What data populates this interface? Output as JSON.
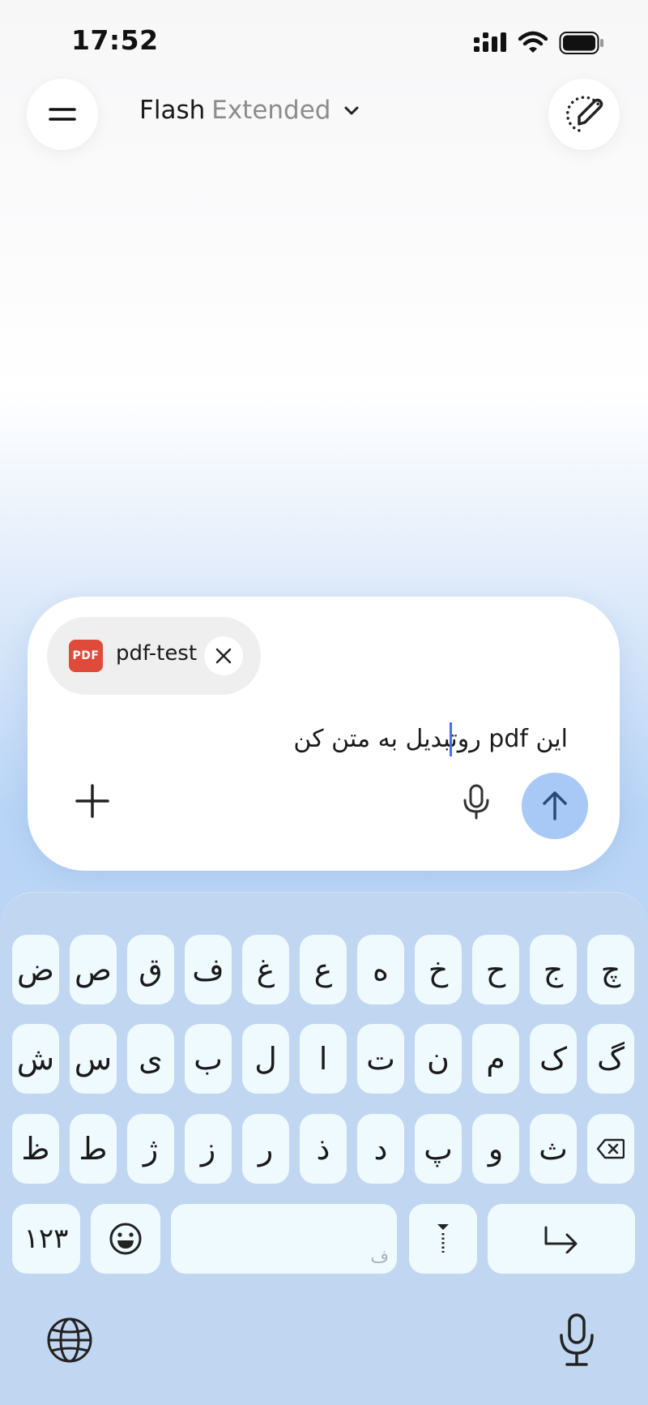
{
  "status_bar": {
    "time": "17:52"
  },
  "header": {
    "model_name": "Flash",
    "model_variant": "Extended",
    "menu_icon": "menu-icon",
    "new_chat_icon": "new-chat-icon"
  },
  "composer": {
    "attachment": {
      "badge": "PDF",
      "name": "pdf-test"
    },
    "message": "این pdf روتبدیل به متن کن",
    "accent_color": "#a8c9f5"
  },
  "keyboard": {
    "row1": [
      "ض",
      "ص",
      "ق",
      "ف",
      "غ",
      "ع",
      "ه",
      "خ",
      "ح",
      "ج",
      "چ"
    ],
    "row2": [
      "ش",
      "س",
      "ی",
      "ب",
      "ل",
      "ا",
      "ت",
      "ن",
      "م",
      "ک",
      "گ"
    ],
    "row3": [
      "ظ",
      "ط",
      "ژ",
      "ز",
      "ر",
      "ذ",
      "د",
      "پ",
      "و",
      "ث"
    ],
    "numbers_label": "۱۲۳",
    "space_hint": "ف",
    "background_color": "#c0d6f1",
    "key_color": "#effaff"
  }
}
